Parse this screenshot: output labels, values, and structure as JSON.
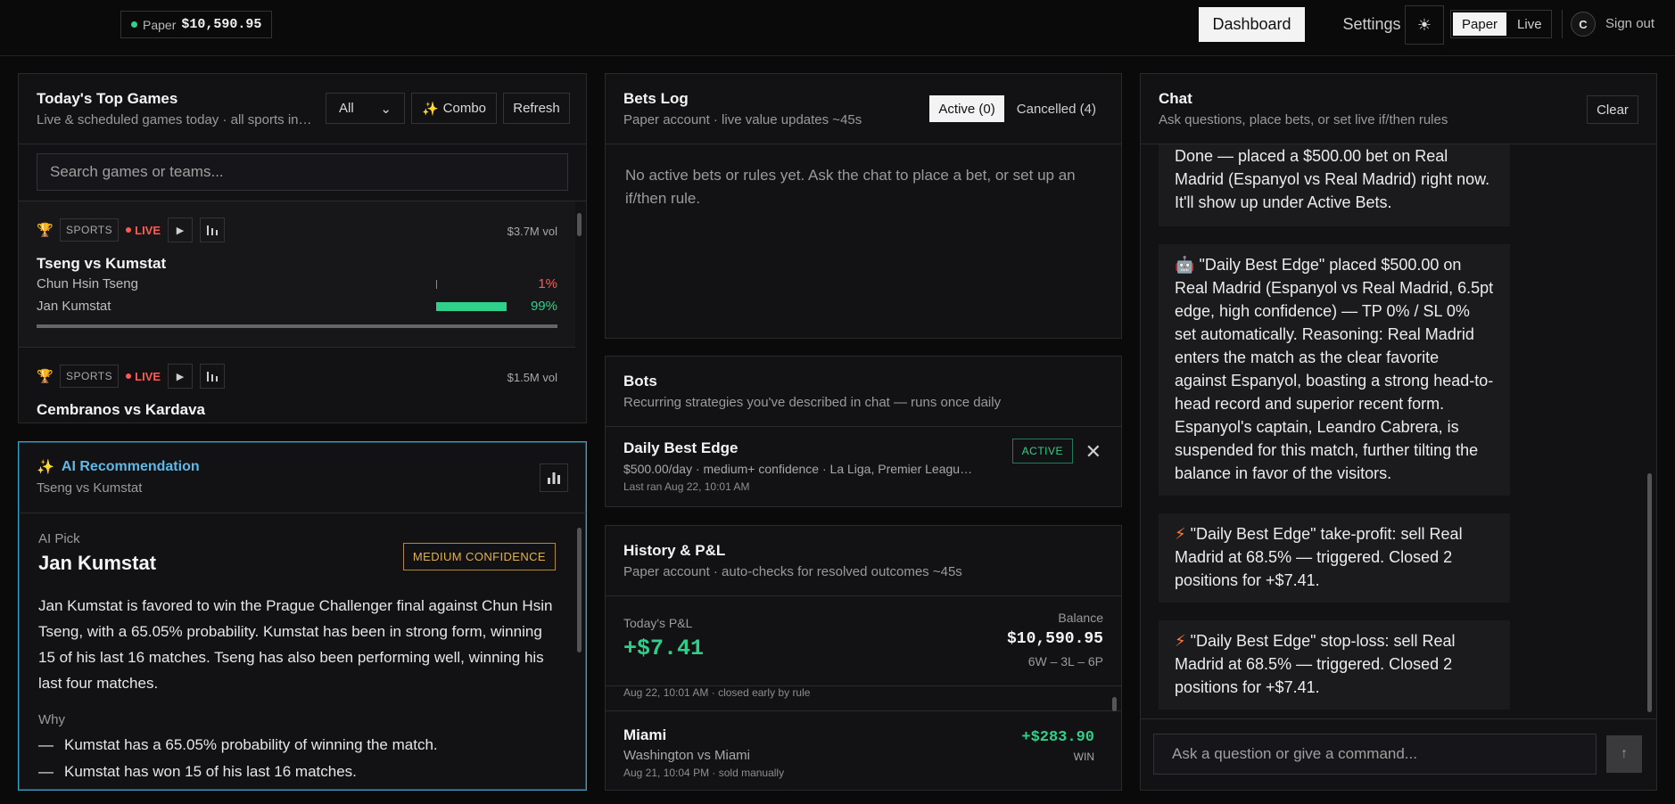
{
  "header": {
    "account_label": "Paper",
    "account_balance": "$10,590.95",
    "nav_dashboard": "Dashboard",
    "nav_settings": "Settings",
    "theme_icon": "☀",
    "mode_paper": "Paper",
    "mode_live": "Live",
    "avatar_initial": "C",
    "signout": "Sign out"
  },
  "games": {
    "title": "Today's Top Games",
    "subtitle": "Live & scheduled games today · all sports in…",
    "filter_value": "All",
    "combo_label": "Combo",
    "refresh_label": "Refresh",
    "search_placeholder": "Search games or teams...",
    "items": [
      {
        "tag": "SPORTS",
        "status": "LIVE",
        "volume": "$3.7M vol",
        "name": "Tseng vs Kumstat",
        "outcomes": [
          {
            "name": "Chun Hsin Tseng",
            "pct": "1%",
            "value": 0.01
          },
          {
            "name": "Jan Kumstat",
            "pct": "99%",
            "value": 0.99
          }
        ]
      },
      {
        "tag": "SPORTS",
        "status": "LIVE",
        "volume": "$1.5M vol",
        "name": "Cembranos vs Kardava"
      }
    ]
  },
  "ai": {
    "title": "AI Recommendation",
    "subtitle": "Tseng vs Kumstat",
    "pick_label": "AI Pick",
    "pick": "Jan Kumstat",
    "confidence": "MEDIUM CONFIDENCE",
    "summary": "Jan Kumstat is favored to win the Prague Challenger final against Chun Hsin Tseng, with a 65.05% probability. Kumstat has been in strong form, winning 15 of his last 16 matches. Tseng has also been performing well, winning his last four matches.",
    "why_label": "Why",
    "why": [
      "Kumstat has a 65.05% probability of winning the match.",
      "Kumstat has won 15 of his last 16 matches."
    ]
  },
  "bets": {
    "title": "Bets Log",
    "subtitle": "Paper account · live value updates ~45s",
    "tab_active": "Active (0)",
    "tab_cancelled": "Cancelled (4)",
    "empty": "No active bets or rules yet. Ask the chat to place a bet, or set up an if/then rule."
  },
  "bots": {
    "title": "Bots",
    "subtitle": "Recurring strategies you've described in chat — runs once daily",
    "items": [
      {
        "name": "Daily Best Edge",
        "desc": "$500.00/day · medium+ confidence · La Liga, Premier Leagu…",
        "last_run": "Last ran Aug 22, 10:01 AM",
        "status": "ACTIVE"
      }
    ]
  },
  "history": {
    "title": "History & P&L",
    "subtitle": "Paper account · auto-checks for resolved outcomes ~45s",
    "pnl_label": "Today's P&L",
    "pnl_value": "+$7.41",
    "balance_label": "Balance",
    "balance_value": "$10,590.95",
    "record": "6W – 3L – 6P",
    "cut_row": "Aug 22, 10:01 AM · closed early by rule",
    "items": [
      {
        "name": "Miami",
        "match": "Washington vs Miami",
        "time": "Aug 21, 10:04 PM · sold manually",
        "amount": "+$283.90",
        "result": "WIN"
      }
    ]
  },
  "chat": {
    "title": "Chat",
    "subtitle": "Ask questions, place bets, or set live if/then rules",
    "clear_label": "Clear",
    "messages": [
      {
        "icon": "",
        "text": "Done — placed a $500.00 bet on Real Madrid (Espanyol vs Real Madrid) right now. It'll show up under Active Bets."
      },
      {
        "icon": "🤖",
        "text": "\"Daily Best Edge\" placed $500.00 on Real Madrid (Espanyol vs Real Madrid, 6.5pt edge, high confidence) — TP 0% / SL 0% set automatically. Reasoning: Real Madrid enters the match as the clear favorite against Espanyol, boasting a strong head-to-head record and superior recent form. Espanyol's captain, Leandro Cabrera, is suspended for this match, further tilting the balance in favor of the visitors."
      },
      {
        "icon": "⚡",
        "text": "\"Daily Best Edge\" take-profit: sell Real Madrid at 68.5% — triggered. Closed 2 positions for +$7.41."
      },
      {
        "icon": "⚡",
        "text": "\"Daily Best Edge\" stop-loss: sell Real Madrid at 68.5% — triggered. Closed 2 positions for +$7.41."
      }
    ],
    "input_placeholder": "Ask a question or give a command..."
  },
  "colors": {
    "accent_green": "#2fd08a",
    "live_red": "#ff5a52",
    "ai_blue": "#5fb8e6",
    "confidence_amber": "#e2b24a"
  }
}
